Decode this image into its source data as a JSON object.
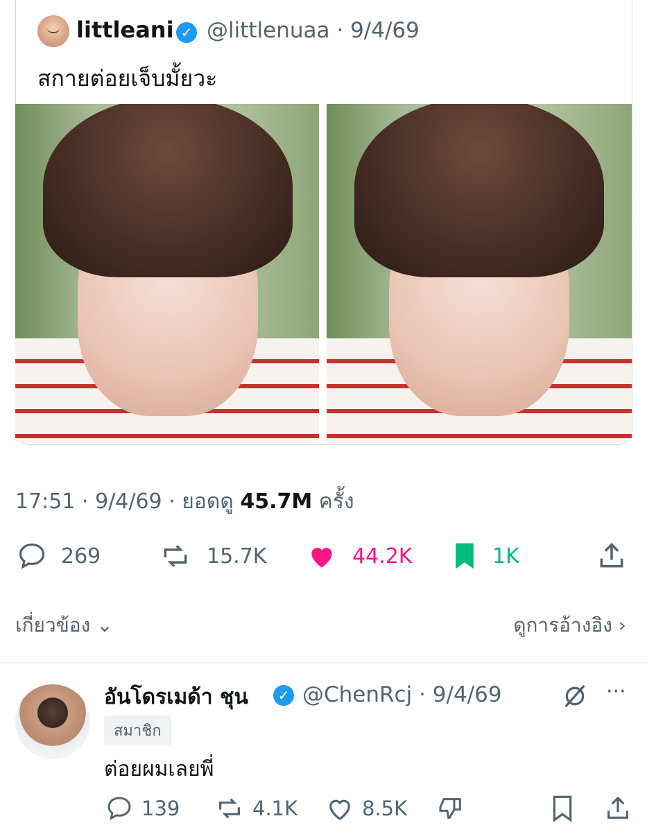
{
  "quoted_post": {
    "display_name": "littleani",
    "handle_date": "@littlenuaa · 9/4/69",
    "text": "สกายต่อยเจ็บมั้ยวะ"
  },
  "post_meta": {
    "time_date": "17:51 · 9/4/69 · ยอดดู",
    "views": "45.7M",
    "views_suffix": "ครั้ง"
  },
  "actions": {
    "replies": "269",
    "reposts": "15.7K",
    "likes": "44.2K",
    "bookmarks": "1K"
  },
  "links": {
    "related": "เกี่ยวข้อง",
    "view_quotes": "ดูการอ้างอิง"
  },
  "reply": {
    "display_name": "อันโดรเมด้า ชุน",
    "handle_date": "@ChenRcj · 9/4/69",
    "badge": "สมาชิก",
    "text": "ต่อยผมเลยพี่",
    "replies": "139",
    "reposts": "4.1K",
    "likes": "8.5K"
  },
  "colors": {
    "like_active": "#f91880",
    "bookmark_active": "#00ba7c",
    "verified": "#1d9bf0",
    "muted_text": "#536471"
  }
}
